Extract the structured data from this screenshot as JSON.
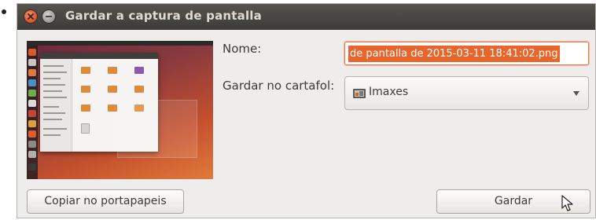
{
  "window": {
    "title": "Gardar a captura de pantalla"
  },
  "form": {
    "name_label": "Nome:",
    "name_value": "de pantalla de 2015-03-11 18:41:02.png",
    "folder_label": "Gardar no cartafol:",
    "folder_value": "Imaxes"
  },
  "buttons": {
    "copy_label": "Copiar no portapapeis",
    "save_label": "Gardar"
  },
  "icons": {
    "close": "close-icon",
    "minimize": "minimize-icon",
    "folder": "pictures-folder-icon",
    "dropdown": "chevron-down-icon",
    "cursor": "mouse-pointer-icon"
  },
  "colors": {
    "titlebar": "#3d3b37",
    "accent": "#e8662c",
    "dialog_bg": "#efedeb"
  }
}
